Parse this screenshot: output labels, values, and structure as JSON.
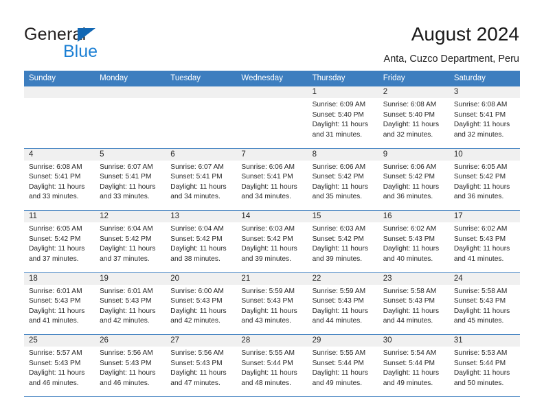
{
  "brand": {
    "name_part1": "General",
    "name_part2": "Blue",
    "triangle_color": "#1368b4",
    "blue_color": "#1b7fd4"
  },
  "header": {
    "title": "August 2024",
    "location": "Anta, Cuzco Department, Peru"
  },
  "theme": {
    "header_row_bg": "#3d7ebf",
    "day_number_bg": "#f0f0f0",
    "grid_line": "#3d7ebf",
    "text": "#262626"
  },
  "weekdays": [
    "Sunday",
    "Monday",
    "Tuesday",
    "Wednesday",
    "Thursday",
    "Friday",
    "Saturday"
  ],
  "labels": {
    "sunrise_prefix": "Sunrise:",
    "sunset_prefix": "Sunset:",
    "daylight_prefix": "Daylight:"
  },
  "weeks": [
    [
      {
        "day": "",
        "line1": "",
        "line2": "",
        "line3": "",
        "line4": ""
      },
      {
        "day": "",
        "line1": "",
        "line2": "",
        "line3": "",
        "line4": ""
      },
      {
        "day": "",
        "line1": "",
        "line2": "",
        "line3": "",
        "line4": ""
      },
      {
        "day": "",
        "line1": "",
        "line2": "",
        "line3": "",
        "line4": ""
      },
      {
        "day": "1",
        "line1": "Sunrise: 6:09 AM",
        "line2": "Sunset: 5:40 PM",
        "line3": "Daylight: 11 hours",
        "line4": "and 31 minutes."
      },
      {
        "day": "2",
        "line1": "Sunrise: 6:08 AM",
        "line2": "Sunset: 5:40 PM",
        "line3": "Daylight: 11 hours",
        "line4": "and 32 minutes."
      },
      {
        "day": "3",
        "line1": "Sunrise: 6:08 AM",
        "line2": "Sunset: 5:41 PM",
        "line3": "Daylight: 11 hours",
        "line4": "and 32 minutes."
      }
    ],
    [
      {
        "day": "4",
        "line1": "Sunrise: 6:08 AM",
        "line2": "Sunset: 5:41 PM",
        "line3": "Daylight: 11 hours",
        "line4": "and 33 minutes."
      },
      {
        "day": "5",
        "line1": "Sunrise: 6:07 AM",
        "line2": "Sunset: 5:41 PM",
        "line3": "Daylight: 11 hours",
        "line4": "and 33 minutes."
      },
      {
        "day": "6",
        "line1": "Sunrise: 6:07 AM",
        "line2": "Sunset: 5:41 PM",
        "line3": "Daylight: 11 hours",
        "line4": "and 34 minutes."
      },
      {
        "day": "7",
        "line1": "Sunrise: 6:06 AM",
        "line2": "Sunset: 5:41 PM",
        "line3": "Daylight: 11 hours",
        "line4": "and 34 minutes."
      },
      {
        "day": "8",
        "line1": "Sunrise: 6:06 AM",
        "line2": "Sunset: 5:42 PM",
        "line3": "Daylight: 11 hours",
        "line4": "and 35 minutes."
      },
      {
        "day": "9",
        "line1": "Sunrise: 6:06 AM",
        "line2": "Sunset: 5:42 PM",
        "line3": "Daylight: 11 hours",
        "line4": "and 36 minutes."
      },
      {
        "day": "10",
        "line1": "Sunrise: 6:05 AM",
        "line2": "Sunset: 5:42 PM",
        "line3": "Daylight: 11 hours",
        "line4": "and 36 minutes."
      }
    ],
    [
      {
        "day": "11",
        "line1": "Sunrise: 6:05 AM",
        "line2": "Sunset: 5:42 PM",
        "line3": "Daylight: 11 hours",
        "line4": "and 37 minutes."
      },
      {
        "day": "12",
        "line1": "Sunrise: 6:04 AM",
        "line2": "Sunset: 5:42 PM",
        "line3": "Daylight: 11 hours",
        "line4": "and 37 minutes."
      },
      {
        "day": "13",
        "line1": "Sunrise: 6:04 AM",
        "line2": "Sunset: 5:42 PM",
        "line3": "Daylight: 11 hours",
        "line4": "and 38 minutes."
      },
      {
        "day": "14",
        "line1": "Sunrise: 6:03 AM",
        "line2": "Sunset: 5:42 PM",
        "line3": "Daylight: 11 hours",
        "line4": "and 39 minutes."
      },
      {
        "day": "15",
        "line1": "Sunrise: 6:03 AM",
        "line2": "Sunset: 5:42 PM",
        "line3": "Daylight: 11 hours",
        "line4": "and 39 minutes."
      },
      {
        "day": "16",
        "line1": "Sunrise: 6:02 AM",
        "line2": "Sunset: 5:43 PM",
        "line3": "Daylight: 11 hours",
        "line4": "and 40 minutes."
      },
      {
        "day": "17",
        "line1": "Sunrise: 6:02 AM",
        "line2": "Sunset: 5:43 PM",
        "line3": "Daylight: 11 hours",
        "line4": "and 41 minutes."
      }
    ],
    [
      {
        "day": "18",
        "line1": "Sunrise: 6:01 AM",
        "line2": "Sunset: 5:43 PM",
        "line3": "Daylight: 11 hours",
        "line4": "and 41 minutes."
      },
      {
        "day": "19",
        "line1": "Sunrise: 6:01 AM",
        "line2": "Sunset: 5:43 PM",
        "line3": "Daylight: 11 hours",
        "line4": "and 42 minutes."
      },
      {
        "day": "20",
        "line1": "Sunrise: 6:00 AM",
        "line2": "Sunset: 5:43 PM",
        "line3": "Daylight: 11 hours",
        "line4": "and 42 minutes."
      },
      {
        "day": "21",
        "line1": "Sunrise: 5:59 AM",
        "line2": "Sunset: 5:43 PM",
        "line3": "Daylight: 11 hours",
        "line4": "and 43 minutes."
      },
      {
        "day": "22",
        "line1": "Sunrise: 5:59 AM",
        "line2": "Sunset: 5:43 PM",
        "line3": "Daylight: 11 hours",
        "line4": "and 44 minutes."
      },
      {
        "day": "23",
        "line1": "Sunrise: 5:58 AM",
        "line2": "Sunset: 5:43 PM",
        "line3": "Daylight: 11 hours",
        "line4": "and 44 minutes."
      },
      {
        "day": "24",
        "line1": "Sunrise: 5:58 AM",
        "line2": "Sunset: 5:43 PM",
        "line3": "Daylight: 11 hours",
        "line4": "and 45 minutes."
      }
    ],
    [
      {
        "day": "25",
        "line1": "Sunrise: 5:57 AM",
        "line2": "Sunset: 5:43 PM",
        "line3": "Daylight: 11 hours",
        "line4": "and 46 minutes."
      },
      {
        "day": "26",
        "line1": "Sunrise: 5:56 AM",
        "line2": "Sunset: 5:43 PM",
        "line3": "Daylight: 11 hours",
        "line4": "and 46 minutes."
      },
      {
        "day": "27",
        "line1": "Sunrise: 5:56 AM",
        "line2": "Sunset: 5:43 PM",
        "line3": "Daylight: 11 hours",
        "line4": "and 47 minutes."
      },
      {
        "day": "28",
        "line1": "Sunrise: 5:55 AM",
        "line2": "Sunset: 5:44 PM",
        "line3": "Daylight: 11 hours",
        "line4": "and 48 minutes."
      },
      {
        "day": "29",
        "line1": "Sunrise: 5:55 AM",
        "line2": "Sunset: 5:44 PM",
        "line3": "Daylight: 11 hours",
        "line4": "and 49 minutes."
      },
      {
        "day": "30",
        "line1": "Sunrise: 5:54 AM",
        "line2": "Sunset: 5:44 PM",
        "line3": "Daylight: 11 hours",
        "line4": "and 49 minutes."
      },
      {
        "day": "31",
        "line1": "Sunrise: 5:53 AM",
        "line2": "Sunset: 5:44 PM",
        "line3": "Daylight: 11 hours",
        "line4": "and 50 minutes."
      }
    ]
  ]
}
